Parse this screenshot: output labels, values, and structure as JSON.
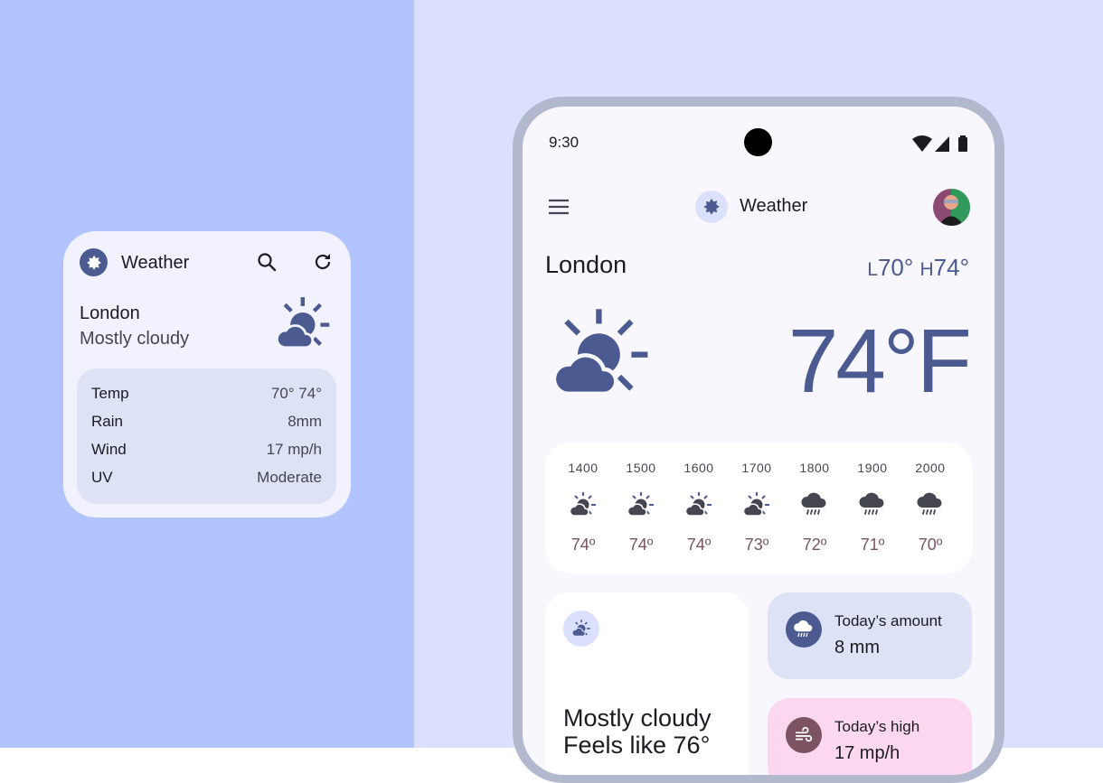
{
  "colors": {
    "accent": "#4b5a91",
    "left_bg": "#b1c4fd",
    "right_bg": "#dbe1fd",
    "temp_color": "#7d5262",
    "wind_card": "#fcd8f0"
  },
  "widget": {
    "title": "Weather",
    "logo_icon": "sun-badge-icon",
    "search_icon": "search-icon",
    "refresh_icon": "refresh-icon",
    "city": "London",
    "condition": "Mostly cloudy",
    "weather_icon": "partly-cloudy-icon",
    "rows": [
      {
        "key": "Temp",
        "value": "70°  74°"
      },
      {
        "key": "Rain",
        "value": "8mm"
      },
      {
        "key": "Wind",
        "value": "17 mp/h"
      },
      {
        "key": "UV",
        "value": "Moderate"
      }
    ]
  },
  "phone": {
    "time": "9:30",
    "app_title": "Weather",
    "city": "London",
    "low_prefix": "L",
    "low": "70°",
    "high_prefix": "H",
    "high": "74°",
    "temperature": "74°F",
    "hourly": [
      {
        "hour": "1400",
        "icon": "partly-cloudy-icon",
        "temp": "74º"
      },
      {
        "hour": "1500",
        "icon": "partly-cloudy-icon",
        "temp": "74º"
      },
      {
        "hour": "1600",
        "icon": "partly-cloudy-icon",
        "temp": "74º"
      },
      {
        "hour": "1700",
        "icon": "partly-cloudy-icon",
        "temp": "73º"
      },
      {
        "hour": "1800",
        "icon": "rain-icon",
        "temp": "72º"
      },
      {
        "hour": "1900",
        "icon": "rain-icon",
        "temp": "71º"
      },
      {
        "hour": "2000",
        "icon": "rain-icon",
        "temp": "70º"
      }
    ],
    "condition_card": {
      "line1": "Mostly cloudy",
      "line2": "Feels like 76°"
    },
    "rain_card": {
      "title": "Today’s amount",
      "value": "8 mm"
    },
    "wind_card": {
      "title": "Today’s high",
      "value": "17 mp/h"
    }
  }
}
